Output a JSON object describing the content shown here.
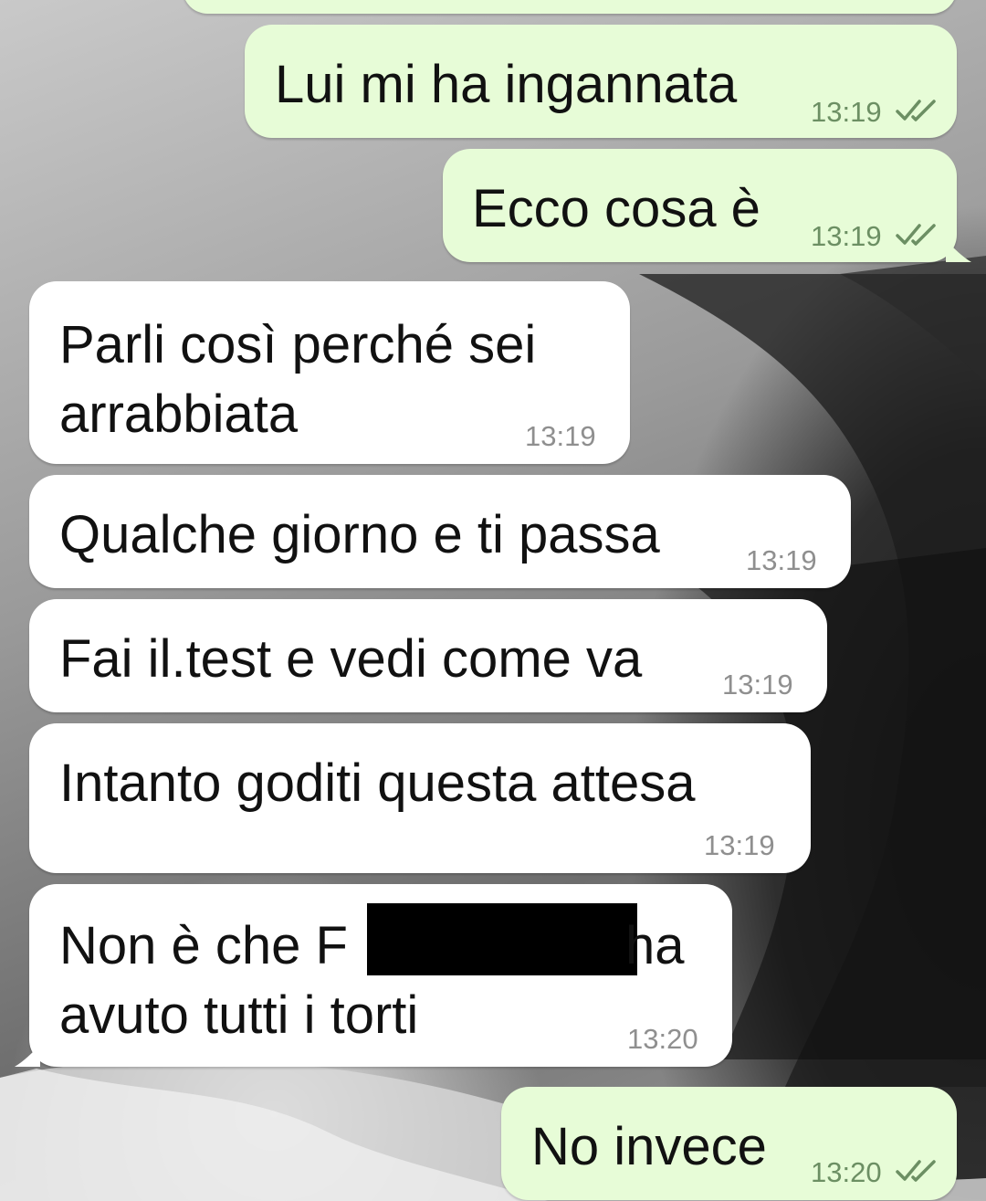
{
  "chat": {
    "colors": {
      "outgoing_bubble": "#e7fcd7",
      "incoming_bubble": "#ffffff",
      "read_tick": "#6c8f63",
      "timestamp_in": "#8f8f8f",
      "timestamp_out": "#6c8f63"
    },
    "messages": [
      {
        "direction": "out",
        "line1": "Lui mi ha ingannata",
        "time": "13:19",
        "status": "read",
        "status_icon": "double-check-icon"
      },
      {
        "direction": "out",
        "line1": "Ecco cosa è",
        "time": "13:19",
        "status": "read",
        "status_icon": "double-check-icon"
      },
      {
        "direction": "in",
        "line1": "Parli così perché sei",
        "line2": "arrabbiata",
        "time": "13:19"
      },
      {
        "direction": "in",
        "line1": "Qualche giorno e ti passa",
        "time": "13:19"
      },
      {
        "direction": "in",
        "line1": "Fai il.test e vedi come va",
        "time": "13:19"
      },
      {
        "direction": "in",
        "line1": "Intanto goditi questa attesa",
        "time": "13:19"
      },
      {
        "direction": "in",
        "line1_a": "Non è che F",
        "line1_b": "ha",
        "line2": "avuto tutti i torti",
        "time": "13:20",
        "redacted": true
      },
      {
        "direction": "out",
        "line1": "No invece",
        "time": "13:20",
        "status": "read",
        "status_icon": "double-check-icon"
      }
    ]
  }
}
